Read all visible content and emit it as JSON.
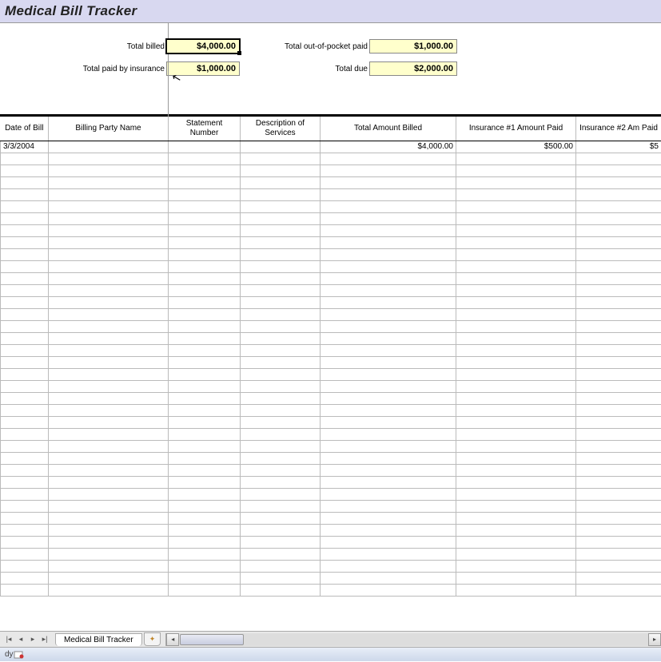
{
  "title": "Medical Bill Tracker",
  "summary": {
    "total_billed_label": "Total billed",
    "total_billed_value": "$4,000.00",
    "total_paid_insurance_label": "Total paid by insurance",
    "total_paid_insurance_value": "$1,000.00",
    "total_oop_label": "Total out-of-pocket paid",
    "total_oop_value": "$1,000.00",
    "total_due_label": "Total due",
    "total_due_value": "$2,000.00"
  },
  "columns": {
    "date": "Date of Bill",
    "party": "Billing Party Name",
    "stmt": "Statement Number",
    "desc": "Description of Services",
    "total": "Total Amount Billed",
    "ins1": "Insurance #1 Amount Paid",
    "ins2": "Insurance #2 Am Paid"
  },
  "rows": [
    {
      "date": "3/3/2004",
      "party": "",
      "stmt": "",
      "desc": "",
      "total": "$4,000.00",
      "ins1": "$500.00",
      "ins2": "$5"
    }
  ],
  "sheet_tab": "Medical Bill Tracker",
  "status": "dy"
}
